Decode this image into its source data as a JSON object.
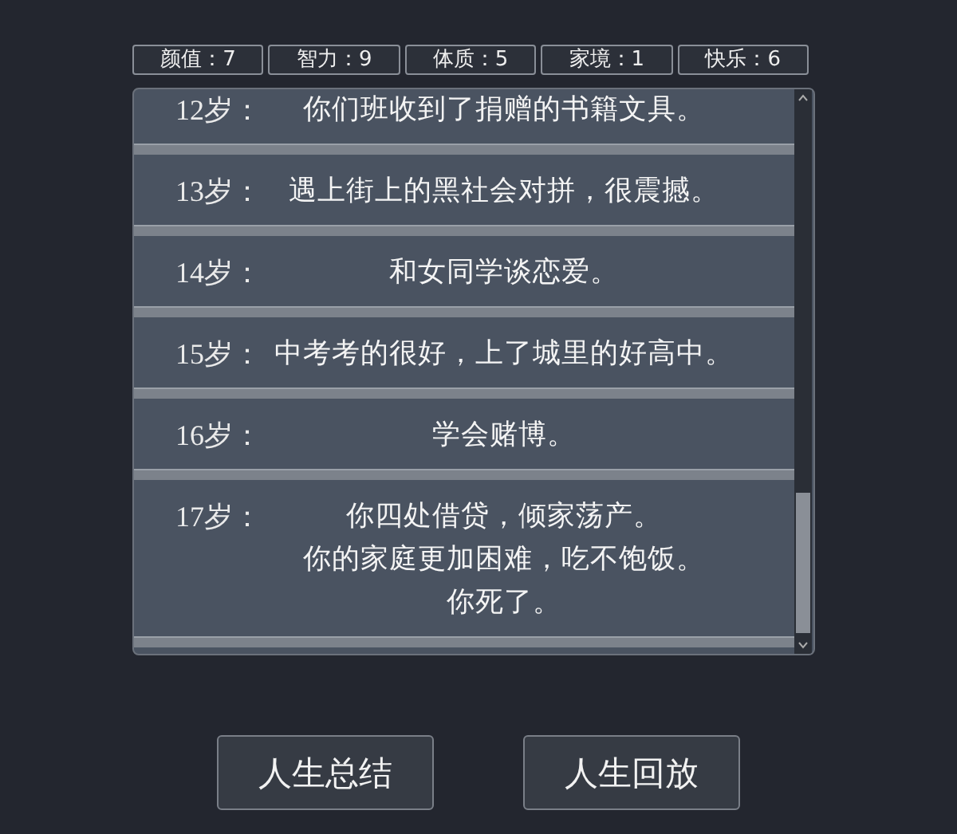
{
  "stats": [
    {
      "label": "颜值：7"
    },
    {
      "label": "智力：9"
    },
    {
      "label": "体质：5"
    },
    {
      "label": "家境：1"
    },
    {
      "label": "快乐：6"
    }
  ],
  "events": [
    {
      "age": "12岁：",
      "lines": [
        "你们班收到了捐赠的书籍文具。"
      ]
    },
    {
      "age": "13岁：",
      "lines": [
        "遇上街上的黑社会对拼，很震撼。"
      ]
    },
    {
      "age": "14岁：",
      "lines": [
        "和女同学谈恋爱。"
      ]
    },
    {
      "age": "15岁：",
      "lines": [
        "中考考的很好，上了城里的好高中。"
      ]
    },
    {
      "age": "16岁：",
      "lines": [
        "学会赌博。"
      ]
    },
    {
      "age": "17岁：",
      "lines": [
        "你四处借贷，倾家荡产。",
        "你的家庭更加困难，吃不饱饭。",
        "你死了。"
      ]
    }
  ],
  "buttons": [
    {
      "label": "人生总结"
    },
    {
      "label": "人生回放"
    }
  ]
}
